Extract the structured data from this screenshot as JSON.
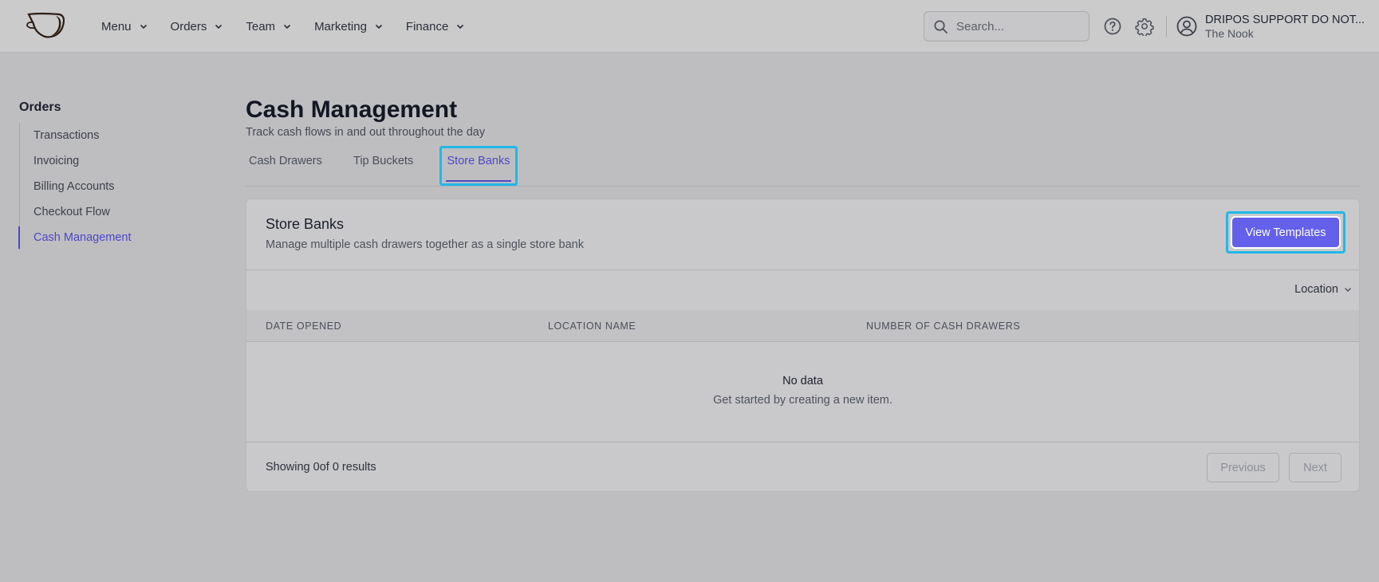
{
  "nav": {
    "items": [
      {
        "label": "Menu"
      },
      {
        "label": "Orders"
      },
      {
        "label": "Team"
      },
      {
        "label": "Marketing"
      },
      {
        "label": "Finance"
      }
    ],
    "search_placeholder": "Search...",
    "user_name": "DRIPOS SUPPORT DO NOT...",
    "user_location": "The Nook"
  },
  "sidebar": {
    "title": "Orders",
    "items": [
      {
        "label": "Transactions"
      },
      {
        "label": "Invoicing"
      },
      {
        "label": "Billing Accounts"
      },
      {
        "label": "Checkout Flow"
      },
      {
        "label": "Cash Management",
        "active": true
      }
    ]
  },
  "page": {
    "title": "Cash Management",
    "subtitle": "Track cash flows in and out throughout the day",
    "tabs": [
      {
        "label": "Cash Drawers"
      },
      {
        "label": "Tip Buckets"
      },
      {
        "label": "Store Banks",
        "active": true
      }
    ]
  },
  "card": {
    "title": "Store Banks",
    "description": "Manage multiple cash drawers together as a single store bank",
    "button_label": "View Templates",
    "filter_label": "Location",
    "columns": [
      "DATE OPENED",
      "LOCATION NAME",
      "NUMBER OF CASH DRAWERS"
    ],
    "empty_title": "No data",
    "empty_subtitle": "Get started by creating a new item.",
    "showing_text": "Showing 0of 0 results",
    "prev_label": "Previous",
    "next_label": "Next"
  },
  "colors": {
    "accent": "#4f46c8",
    "primary_button": "#6460ea",
    "highlight": "#20b8e8"
  }
}
